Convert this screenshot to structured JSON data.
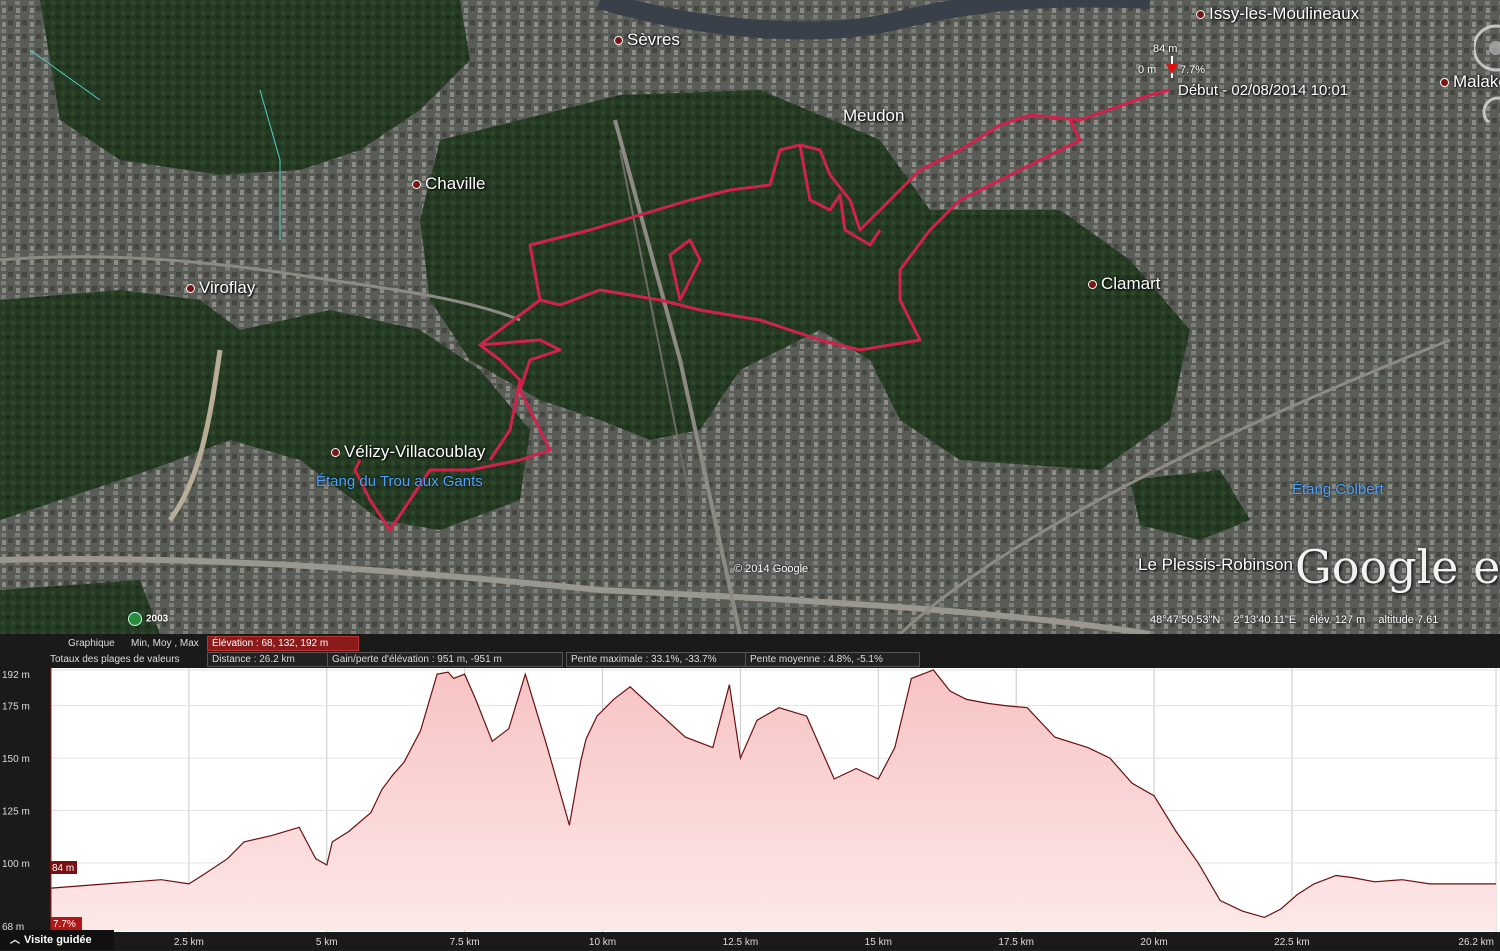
{
  "map": {
    "places": [
      {
        "name": "Sèvres"
      },
      {
        "name": "Issy-les-Moulineaux"
      },
      {
        "name": "Malakoff"
      },
      {
        "name": "Meudon"
      },
      {
        "name": "Chaville"
      },
      {
        "name": "Viroflay"
      },
      {
        "name": "Clamart"
      },
      {
        "name": "Vélizy-Villacoublay"
      },
      {
        "name": "Le Plessis-Robinson"
      }
    ],
    "lakes": [
      {
        "name": "Étang du Trou aux Gants"
      },
      {
        "name": "Étang Colbert"
      }
    ],
    "track_color": "#d0224a",
    "start_marker": {
      "elevation_label": "84 m",
      "distance_label": "0 m",
      "grade_label": "7.7%",
      "text": "Début - 02/08/2014 10:01"
    },
    "copyright": "© 2014 Google",
    "logo": "Google ear",
    "imagery_year": "2003",
    "status": {
      "lat": "48°47'50.53\"N",
      "lon": "2°13'40.11\"E",
      "elev": "élév.  127 m",
      "altitude": "altitude   7.61"
    }
  },
  "profile": {
    "header": {
      "graph_label": "Graphique",
      "mode_label": "Min, Moy , Max",
      "elevation": "Élévation : 68, 132, 192 m",
      "totals_label": "Totaux des plages de valeurs",
      "distance": "Distance : 26.2 km",
      "gain": "Gain/perte d'élévation : 951 m, -951 m",
      "max_slope": "Pente maximale : 33.1%, -33.7%",
      "avg_slope": "Pente moyenne : 4.8%, -5.1%"
    },
    "cursor": {
      "elevation": "84 m",
      "grade": "7.7%"
    },
    "tour_button": "Visite guidée"
  },
  "chart_data": {
    "type": "area",
    "xlabel": "",
    "ylabel": "",
    "x_unit": "km",
    "y_unit": "m",
    "xlim": [
      0,
      26.2
    ],
    "ylim": [
      68,
      192
    ],
    "x_tick_labels": [
      "2.5 km",
      "5 km",
      "7.5 km",
      "10 km",
      "12.5 km",
      "15 km",
      "17.5 km",
      "20 km",
      "22.5 km",
      "26.2 km"
    ],
    "x_ticks": [
      2.5,
      5,
      7.5,
      10,
      12.5,
      15,
      17.5,
      20,
      22.5,
      26.2
    ],
    "y_tick_labels": [
      "192 m",
      "175 m",
      "150 m",
      "125 m",
      "100 m",
      "68 m"
    ],
    "y_ticks": [
      192,
      175,
      150,
      125,
      100,
      68
    ],
    "fill_color": "#f7c3c3",
    "line_color": "#6b0f0f",
    "series": [
      {
        "x": [
          0,
          0.5,
          1.0,
          1.5,
          2.0,
          2.5,
          2.8,
          3.2,
          3.5,
          4.0,
          4.5,
          4.8,
          5.0,
          5.1,
          5.4,
          5.8,
          6.0,
          6.2,
          6.4,
          6.7,
          7.0,
          7.2,
          7.3,
          7.5,
          7.7,
          8.0,
          8.3,
          8.6,
          9.0,
          9.4,
          9.6,
          9.7,
          9.9,
          10.2,
          10.5,
          11.0,
          11.5,
          12.0,
          12.3,
          12.5,
          12.8,
          13.2,
          13.7,
          14.2,
          14.6,
          15.0,
          15.3,
          15.6,
          16.0,
          16.3,
          16.6,
          17.0,
          17.3,
          17.7,
          18.2,
          18.8,
          19.2,
          19.6,
          20.0,
          20.4,
          20.8,
          21.2,
          21.6,
          22.0,
          22.3,
          22.6,
          22.9,
          23.3,
          23.6,
          24.0,
          24.5,
          25.0,
          25.5,
          26.2
        ],
        "y": [
          88,
          89,
          90,
          91,
          92,
          90,
          95,
          102,
          110,
          113,
          117,
          102,
          99,
          110,
          115,
          124,
          135,
          142,
          148,
          163,
          190,
          191,
          188,
          190,
          178,
          158,
          164,
          190,
          155,
          118,
          148,
          159,
          170,
          178,
          184,
          172,
          160,
          155,
          185,
          150,
          168,
          174,
          170,
          140,
          145,
          140,
          155,
          188,
          192,
          182,
          178,
          176,
          175,
          174,
          160,
          155,
          150,
          138,
          132,
          115,
          100,
          82,
          77,
          74,
          78,
          85,
          90,
          94,
          93,
          91,
          92,
          90,
          90,
          90
        ]
      }
    ]
  }
}
